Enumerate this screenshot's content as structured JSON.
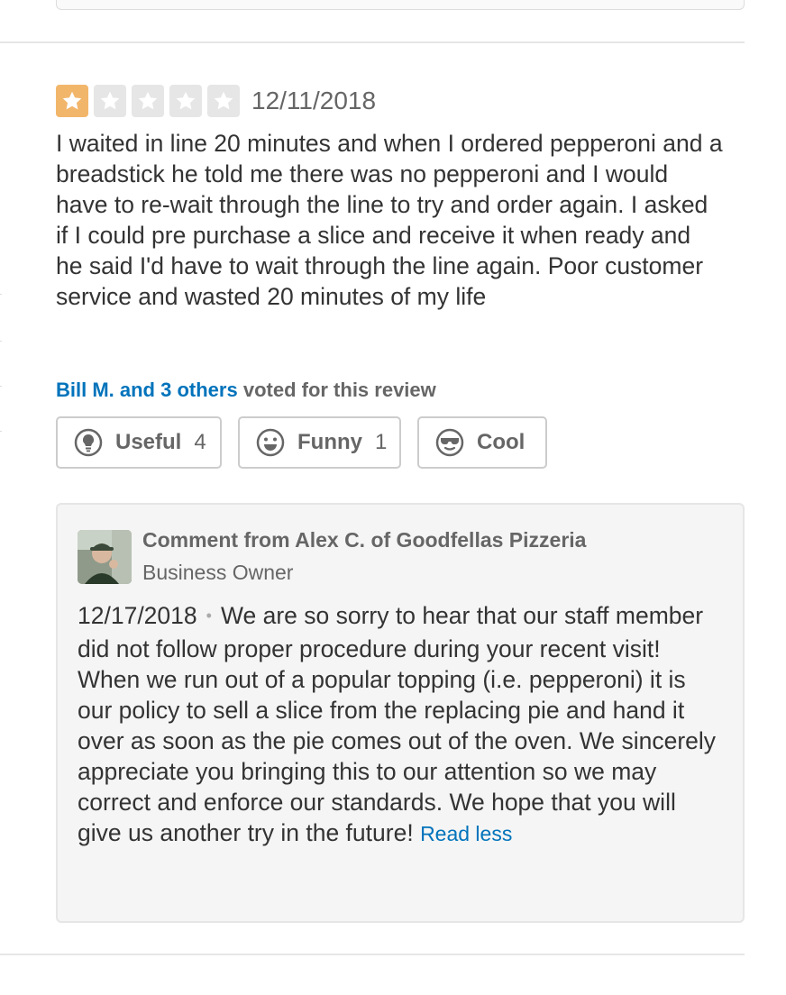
{
  "review": {
    "rating": 1,
    "rating_max": 5,
    "date": "12/11/2018",
    "text": "I waited in line 20 minutes and when I ordered pepperoni and a breadstick he told me there was no pepperoni and I would have to re-wait through the line to try and order again. I asked if I could pre purchase a slice and receive it when ready and he said I'd have to wait through the line again. Poor customer service and wasted 20 minutes of my life"
  },
  "votes": {
    "voters": "Bill M. and 3 others",
    "suffix": "voted for this review",
    "buttons": {
      "useful": {
        "label": "Useful",
        "count": "4",
        "icon": "lightbulb-icon"
      },
      "funny": {
        "label": "Funny",
        "count": "1",
        "icon": "smiley-icon"
      },
      "cool": {
        "label": "Cool",
        "count": "",
        "icon": "sunglasses-icon"
      }
    }
  },
  "owner_comment": {
    "title": "Comment from Alex C. of Goodfellas Pizzeria",
    "role": "Business Owner",
    "date": "12/17/2018",
    "separator": "•",
    "text": "We are so sorry to hear that our staff member did not follow proper procedure during your recent visit! When we run out of a popular topping (i.e. pepperoni) it is our policy to sell a slice from the replacing pie and hand it over as soon as the pie comes out of the oven. We sincerely appreciate you bringing this to our attention so we may correct and enforce our standards. We hope that you will give us another try in the future!",
    "read_less": "Read less"
  },
  "colors": {
    "star_filled": "#f2b66b",
    "star_empty": "#e6e6e6",
    "link": "#0073bb",
    "text": "#333333",
    "muted": "#666666"
  }
}
